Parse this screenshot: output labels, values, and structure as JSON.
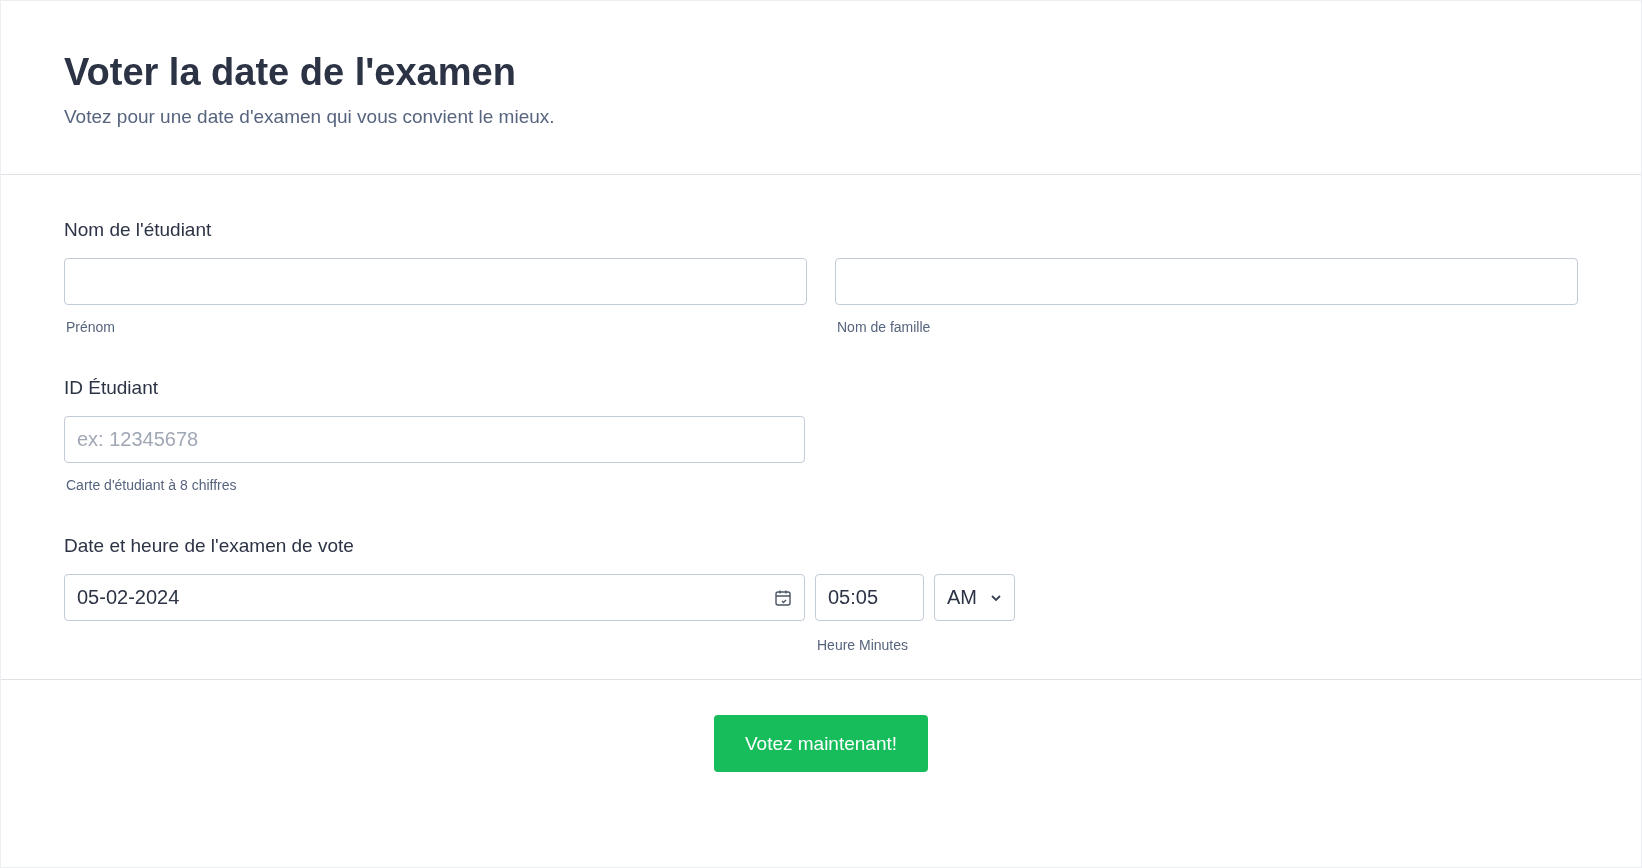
{
  "header": {
    "title": "Voter la date de l'examen",
    "subtitle": "Votez pour une date d'examen qui vous convient le mieux."
  },
  "student_name": {
    "label": "Nom de l'étudiant",
    "first": {
      "sublabel": "Prénom"
    },
    "last": {
      "sublabel": "Nom de famille"
    }
  },
  "student_id": {
    "label": "ID Étudiant",
    "placeholder": "ex: 12345678",
    "sublabel": "Carte d'étudiant à 8 chiffres"
  },
  "exam_datetime": {
    "label": "Date et heure de l'examen de vote",
    "date": "05-02-2024",
    "time": "05:05",
    "ampm": "AM",
    "sublabel": "Heure Minutes"
  },
  "submit": {
    "label": "Votez maintenant!"
  }
}
